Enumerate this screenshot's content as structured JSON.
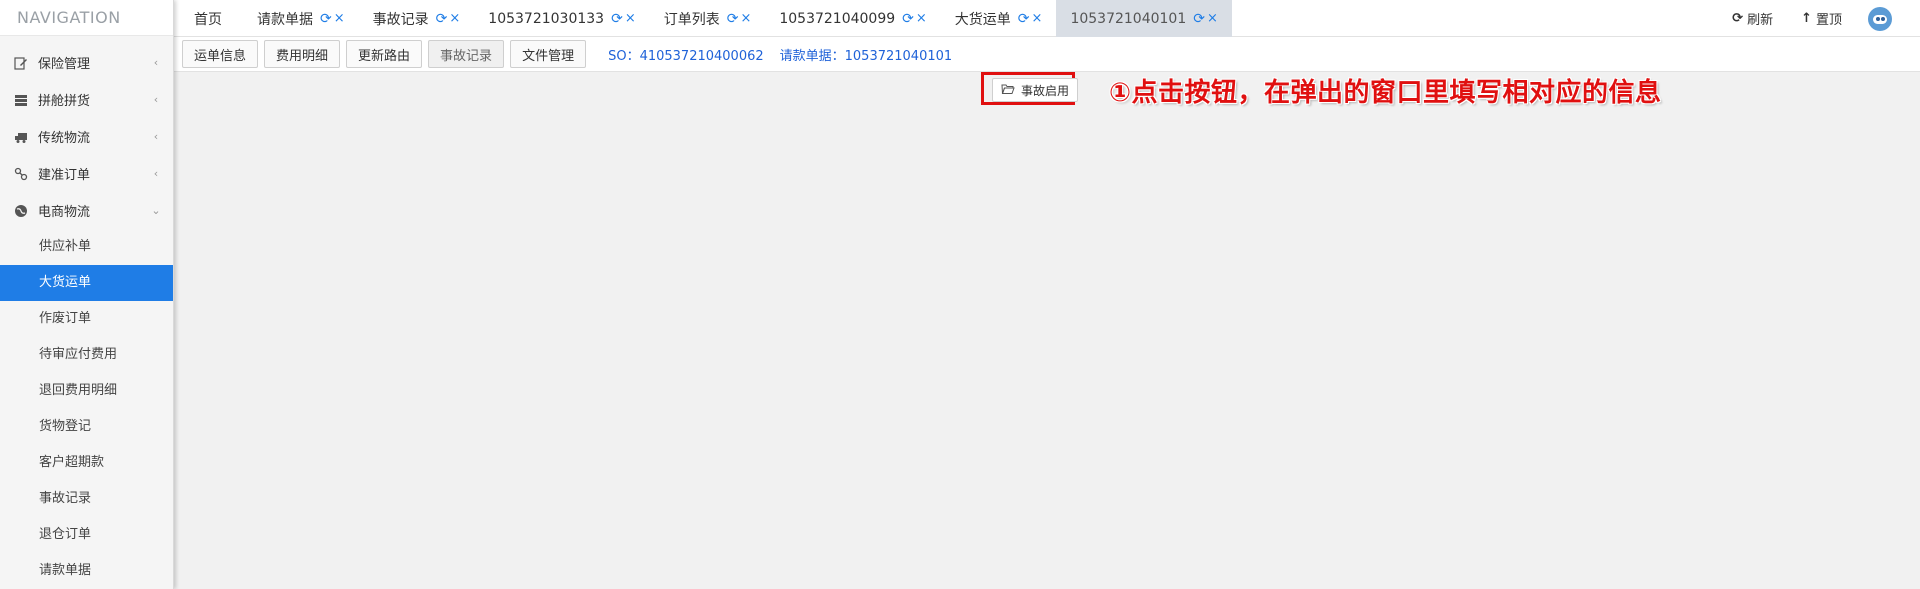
{
  "sidebar": {
    "title": "NAVIGATION",
    "menus": [
      {
        "label": "保险管理",
        "icon": "document-edit-icon",
        "arrow": "‹"
      },
      {
        "label": "拼舱拼货",
        "icon": "server-icon",
        "arrow": "‹"
      },
      {
        "label": "传统物流",
        "icon": "truck-icon",
        "arrow": "‹"
      },
      {
        "label": "建准订单",
        "icon": "link-icon",
        "arrow": "‹"
      },
      {
        "label": "电商物流",
        "icon": "globe-icon",
        "arrow": "⌄"
      }
    ],
    "submenu": [
      {
        "label": "供应补单"
      },
      {
        "label": "大货运单"
      },
      {
        "label": "作废订单"
      },
      {
        "label": "待审应付费用"
      },
      {
        "label": "退回费用明细"
      },
      {
        "label": "货物登记"
      },
      {
        "label": "客户超期款"
      },
      {
        "label": "事故记录"
      },
      {
        "label": "退仓订单"
      },
      {
        "label": "请款单据"
      }
    ]
  },
  "tabs": [
    {
      "label": "首页"
    },
    {
      "label": "请款单据"
    },
    {
      "label": "事故记录"
    },
    {
      "label": "1053721030133"
    },
    {
      "label": "订单列表"
    },
    {
      "label": "1053721040099"
    },
    {
      "label": "大货运单"
    },
    {
      "label": "1053721040101"
    }
  ],
  "tab_icons": {
    "refresh": "⟳",
    "close": "×"
  },
  "top_actions": {
    "refresh_label": "刷新",
    "top_label": "置顶"
  },
  "subbar": {
    "buttons": [
      {
        "label": "运单信息"
      },
      {
        "label": "费用明细"
      },
      {
        "label": "更新路由"
      },
      {
        "label": "事故记录"
      },
      {
        "label": "文件管理"
      }
    ],
    "so_text": "SO：410537210400062",
    "request_text": "请款单据：1053721040101"
  },
  "content": {
    "action_button_label": "事故启用",
    "annotation": "①点击按钮，在弹出的窗口里填写相对应的信息"
  },
  "colors": {
    "accent": "#1f7de6",
    "annotation": "#e01010",
    "link": "#1f62d8"
  }
}
